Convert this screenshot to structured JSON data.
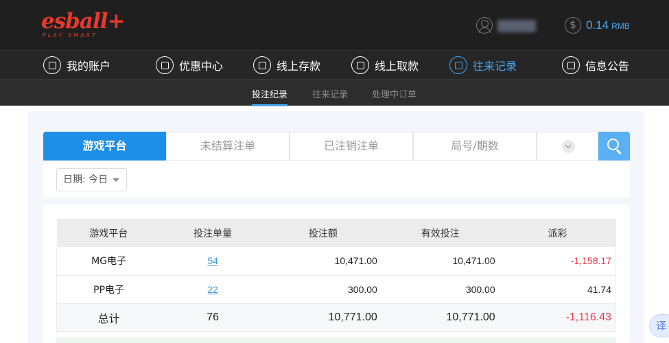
{
  "brand": {
    "logo_text": "esball+",
    "tagline": "PLAY SMART"
  },
  "account": {
    "balance": "0.14",
    "currency": "RMB"
  },
  "nav": [
    {
      "label": "我的账户",
      "icon": "user-icon"
    },
    {
      "label": "优惠中心",
      "icon": "gift-icon"
    },
    {
      "label": "线上存款",
      "icon": "deposit-icon"
    },
    {
      "label": "线上取款",
      "icon": "withdraw-icon"
    },
    {
      "label": "往来记录",
      "icon": "records-icon",
      "active": true
    },
    {
      "label": "信息公告",
      "icon": "bell-icon"
    }
  ],
  "subnav": [
    {
      "label": "投注纪录",
      "active": true
    },
    {
      "label": "往来记录"
    },
    {
      "label": "处理中订单"
    }
  ],
  "tabs": [
    {
      "label": "游戏平台",
      "active": true
    },
    {
      "label": "未结算注单"
    },
    {
      "label": "已注销注单"
    },
    {
      "label": "局号/期数"
    }
  ],
  "filter": {
    "date_label": "日期: 今日"
  },
  "table": {
    "headers": [
      "游戏平台",
      "投注单量",
      "投注额",
      "有效投注",
      "派彩"
    ],
    "rows": [
      {
        "platform": "MG电子",
        "count": "54",
        "bet": "10,471.00",
        "valid": "10,471.00",
        "payout": "-1,158.17"
      },
      {
        "platform": "PP电子",
        "count": "22",
        "bet": "300.00",
        "valid": "300.00",
        "payout": "41.74"
      }
    ],
    "total": {
      "label": "总计",
      "count": "76",
      "bet": "10,771.00",
      "valid": "10,771.00",
      "payout": "-1,116.43"
    }
  },
  "colors": {
    "accent": "#4aa7ef",
    "brand_red": "#e8392c",
    "negative": "#e8394c"
  },
  "translate_label": "译"
}
